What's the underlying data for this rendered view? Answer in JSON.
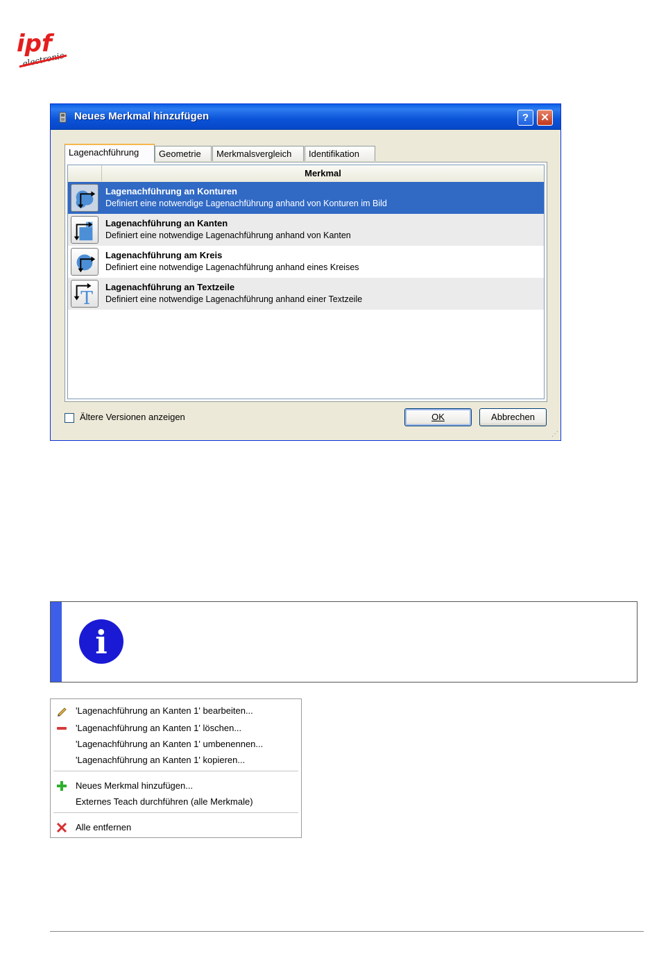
{
  "logo": {
    "big": "ipf",
    "small": "electronic"
  },
  "dialog": {
    "title": "Neues Merkmal hinzufügen",
    "help_label": "?",
    "close_label": "✕",
    "tabs": [
      {
        "label": "Lagenachführung"
      },
      {
        "label": "Geometrie"
      },
      {
        "label": "Merkmalsvergleich"
      },
      {
        "label": "Identifikation"
      }
    ],
    "column_header": "Merkmal",
    "items": [
      {
        "name": "Lagenachführung an Konturen",
        "desc": "Definiert eine notwendige Lagenachführung anhand von Konturen im Bild",
        "icon": "contour-tracking-icon"
      },
      {
        "name": "Lagenachführung an Kanten",
        "desc": "Definiert eine notwendige Lagenachführung anhand von Kanten",
        "icon": "edge-tracking-icon"
      },
      {
        "name": "Lagenachführung am Kreis",
        "desc": "Definiert eine notwendige Lagenachführung anhand eines Kreises",
        "icon": "circle-tracking-icon"
      },
      {
        "name": "Lagenachführung an Textzeile",
        "desc": "Definiert eine notwendige Lagenachführung anhand einer Textzeile",
        "icon": "textline-tracking-icon"
      }
    ],
    "checkbox_label": "Ältere Versionen anzeigen",
    "ok_label": "OK",
    "cancel_label": "Abbrechen",
    "accent": "#316ac5"
  },
  "info": {
    "icon": "info-icon",
    "glyph": "i",
    "color": "#1a1ad4"
  },
  "menu": {
    "items": [
      {
        "label": "'Lagenachführung an Kanten 1' bearbeiten...",
        "icon": "pencil-icon"
      },
      {
        "label": "'Lagenachführung an Kanten 1' löschen...",
        "icon": "minus-icon"
      },
      {
        "label": "'Lagenachführung an Kanten 1' umbenennen...",
        "icon": ""
      },
      {
        "label": "'Lagenachführung an Kanten 1' kopieren...",
        "icon": ""
      },
      {
        "label": "Neues Merkmal hinzufügen...",
        "icon": "plus-icon"
      },
      {
        "label": "Externes Teach durchführen (alle Merkmale)",
        "icon": ""
      },
      {
        "label": "Alle entfernen",
        "icon": "red-x-icon"
      }
    ]
  }
}
